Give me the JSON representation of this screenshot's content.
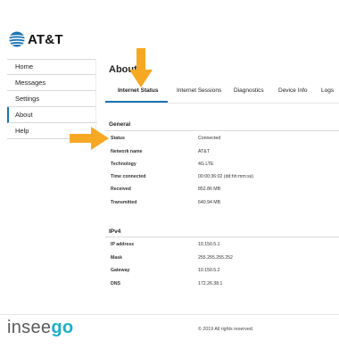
{
  "brand": {
    "name": "AT&T",
    "icon": "att-globe-icon",
    "color": "#1a73b5"
  },
  "sidebar": {
    "items": [
      {
        "label": "Home",
        "active": false
      },
      {
        "label": "Messages",
        "active": false
      },
      {
        "label": "Settings",
        "active": false
      },
      {
        "label": "About",
        "active": true
      },
      {
        "label": "Help",
        "active": false
      }
    ]
  },
  "page": {
    "title": "About"
  },
  "tabs": [
    {
      "label": "Internet Status",
      "active": true
    },
    {
      "label": "Internet Sessions",
      "active": false
    },
    {
      "label": "Diagnostics",
      "active": false
    },
    {
      "label": "Device Info",
      "active": false
    },
    {
      "label": "Logs",
      "active": false
    }
  ],
  "general": {
    "title": "General",
    "rows": [
      {
        "label": "Status",
        "value": "Connected"
      },
      {
        "label": "Network name",
        "value": "AT&T"
      },
      {
        "label": "Technology",
        "value": "4G LTE"
      },
      {
        "label": "Time connected",
        "value": "00:00:36:02 (dd:hh:mm:ss)"
      },
      {
        "label": "Received",
        "value": "852.86 MB"
      },
      {
        "label": "Transmitted",
        "value": "640.94 MB"
      }
    ]
  },
  "ipv4": {
    "title": "IPv4",
    "rows": [
      {
        "label": "IP address",
        "value": "10.150.5.1"
      },
      {
        "label": "Mask",
        "value": "255.255.255.252"
      },
      {
        "label": "Gateway",
        "value": "10.150.5.2"
      },
      {
        "label": "DNS",
        "value": "172.26.38.1"
      }
    ]
  },
  "footer": {
    "logo_prefix": "insee",
    "logo_suffix": "go",
    "copyright": "© 2019 All rights reserved."
  },
  "annotation_color": "#f7a823"
}
